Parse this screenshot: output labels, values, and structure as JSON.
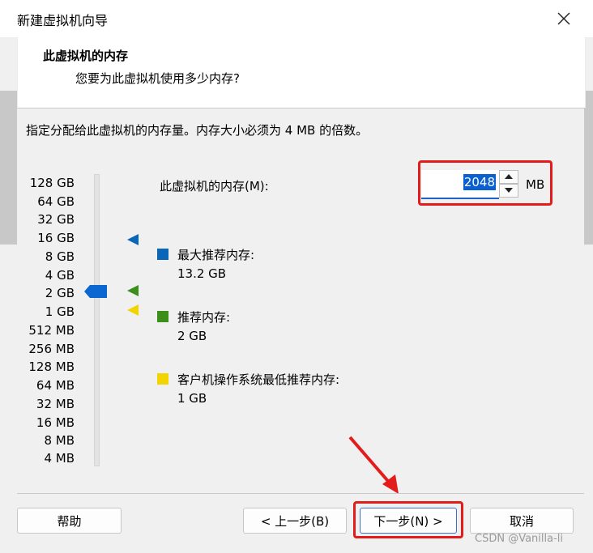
{
  "window": {
    "title": "新建虚拟机向导",
    "close_icon": "close-icon"
  },
  "header": {
    "title": "此虚拟机的内存",
    "subtitle": "您要为此虚拟机使用多少内存?"
  },
  "instruction": "指定分配给此虚拟机的内存量。内存大小必须为 4 MB 的倍数。",
  "scale": {
    "labels": [
      "128 GB",
      "64 GB",
      "32 GB",
      "16 GB",
      "8 GB",
      "4 GB",
      "2 GB",
      "1 GB",
      "512 MB",
      "256 MB",
      "128 MB",
      "64 MB",
      "32 MB",
      "16 MB",
      "8 MB",
      "4 MB"
    ],
    "selected": "2 GB"
  },
  "memory": {
    "label": "此虚拟机的内存(M):",
    "value": "2048",
    "unit": "MB"
  },
  "legend": {
    "max_title": "最大推荐内存:",
    "max_value": "13.2 GB",
    "max_color": "#0a66b7",
    "rec_title": "推荐内存:",
    "rec_value": "2 GB",
    "rec_color": "#3b8f1a",
    "min_title": "客户机操作系统最低推荐内存:",
    "min_value": "1 GB",
    "min_color": "#f2d500"
  },
  "buttons": {
    "help": "帮助",
    "back": "< 上一步(B)",
    "next": "下一步(N) >",
    "cancel": "取消"
  },
  "watermark": "CSDN @Vanilla-li",
  "annotation_color": "#e31b1b"
}
